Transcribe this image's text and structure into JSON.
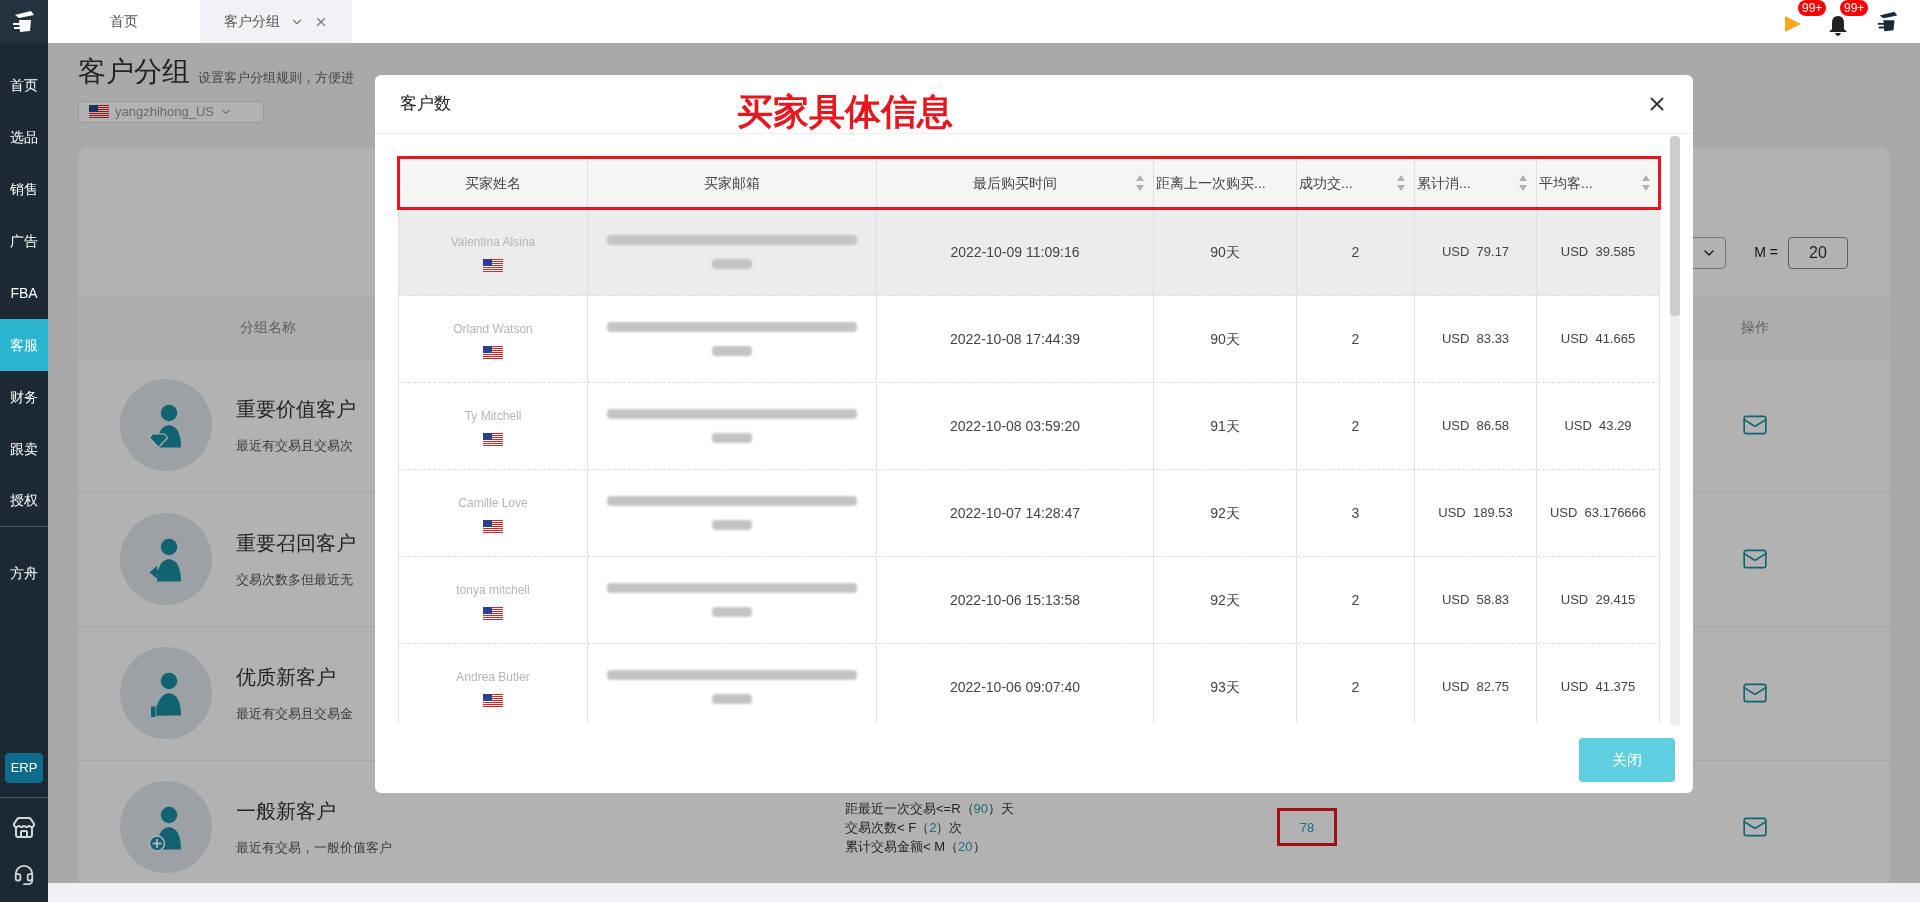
{
  "sidebar": {
    "items": [
      {
        "label": "首页",
        "selected": false,
        "divider_after": false
      },
      {
        "label": "选品",
        "selected": false,
        "divider_after": false
      },
      {
        "label": "销售",
        "selected": false,
        "divider_after": false
      },
      {
        "label": "广告",
        "selected": false,
        "divider_after": false
      },
      {
        "label": "FBA",
        "selected": false,
        "divider_after": false
      },
      {
        "label": "客服",
        "selected": true,
        "divider_after": false
      },
      {
        "label": "财务",
        "selected": false,
        "divider_after": false
      },
      {
        "label": "跟卖",
        "selected": false,
        "divider_after": false
      },
      {
        "label": "授权",
        "selected": false,
        "divider_after": true
      },
      {
        "label": "方舟",
        "selected": false,
        "divider_after": false
      }
    ],
    "erp": "ERP"
  },
  "tabs": [
    {
      "label": "首页",
      "selected": false,
      "closable": false
    },
    {
      "label": "客户分组",
      "selected": true,
      "closable": true
    }
  ],
  "top_bar": {
    "flag_badge": "99+",
    "bell_badge": "99+"
  },
  "page": {
    "title": "客户分组",
    "subtitle": "设置客户分组规则，方便进",
    "store": "yangzhihong_US",
    "m_label": "M =",
    "m_value": "20",
    "name_column": "分组名称",
    "action_column": "操作",
    "groups": [
      {
        "kind": "diamond",
        "name": "重要价值客户",
        "desc": "最近有交易且交易次"
      },
      {
        "kind": "return",
        "name": "重要召回客户",
        "desc": "交易次数多但最近无"
      },
      {
        "kind": "thumb",
        "name": "优质新客户",
        "desc": "最近有交易且交易金"
      },
      {
        "kind": "plus",
        "name": "一般新客户",
        "desc": "最近有交易，一般价值客户",
        "count": "78",
        "count_highlighted": true,
        "rules": [
          {
            "prefix": "距最近一次交易<=R（",
            "value": "90",
            "suffix": "）天"
          },
          {
            "prefix": "交易次数< F（",
            "value": "2",
            "suffix": "）次"
          },
          {
            "prefix": "累计交易金额< M（",
            "value": "20",
            "suffix": "）"
          }
        ]
      }
    ]
  },
  "modal": {
    "title": "客户数",
    "annotation": "买家具体信息",
    "close_button": "关闭",
    "columns": [
      {
        "label": "买家姓名",
        "sortable": false
      },
      {
        "label": "买家邮箱",
        "sortable": false
      },
      {
        "label": "最后购买时间",
        "sortable": true
      },
      {
        "label": "距离上一次购买...",
        "sortable": false
      },
      {
        "label": "成功交...",
        "sortable": true
      },
      {
        "label": "累计消...",
        "sortable": true
      },
      {
        "label": "平均客...",
        "sortable": true
      }
    ],
    "rows": [
      {
        "name": "Valentina Alsina",
        "time": "2022-10-09 11:09:16",
        "days": "90天",
        "count": "2",
        "total": "USD  79.17",
        "avg": "USD  39.585",
        "highlighted": true
      },
      {
        "name": "Orland Watson",
        "time": "2022-10-08 17:44:39",
        "days": "90天",
        "count": "2",
        "total": "USD  83.33",
        "avg": "USD  41.665",
        "highlighted": false
      },
      {
        "name": "Ty Mitchell",
        "time": "2022-10-08 03:59:20",
        "days": "91天",
        "count": "2",
        "total": "USD  86.58",
        "avg": "USD  43.29",
        "highlighted": false
      },
      {
        "name": "Camille Love",
        "time": "2022-10-07 14:28:47",
        "days": "92天",
        "count": "3",
        "total": "USD  189.53",
        "avg": "USD  63.176666",
        "highlighted": false
      },
      {
        "name": "tonya mitchell",
        "time": "2022-10-06 15:13:58",
        "days": "92天",
        "count": "2",
        "total": "USD  58.83",
        "avg": "USD  29.415",
        "highlighted": false
      },
      {
        "name": "Andrea Butler",
        "time": "2022-10-06 09:07:40",
        "days": "93天",
        "count": "2",
        "total": "USD  82.75",
        "avg": "USD  41.375",
        "highlighted": false
      }
    ]
  }
}
